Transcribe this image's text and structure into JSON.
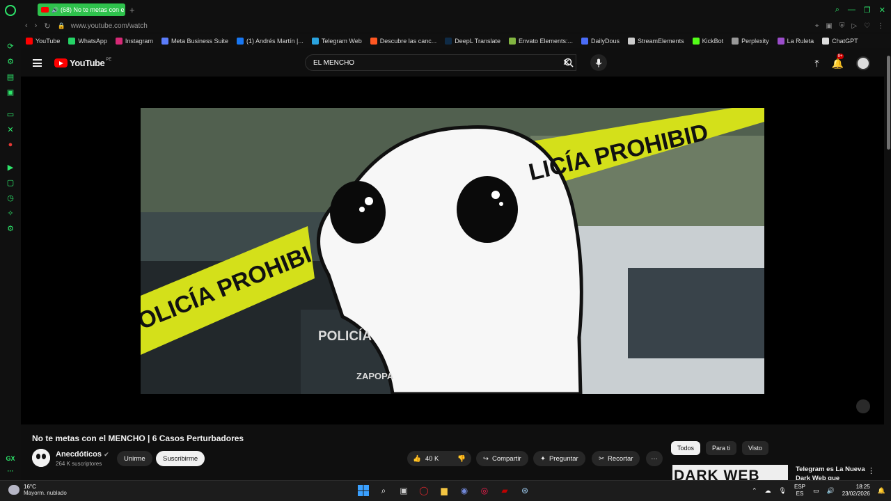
{
  "browser": {
    "tab_title": "(68) No te metas con e",
    "url": "www.youtube.com/watch",
    "bookmarks": [
      {
        "label": "YouTube",
        "color": "#ff0000"
      },
      {
        "label": "WhatsApp",
        "color": "#25d366"
      },
      {
        "label": "Instagram",
        "color": "#d62976"
      },
      {
        "label": "Meta Business Suite",
        "color": "#5b7cfa"
      },
      {
        "label": "(1) Andrés Martín |...",
        "color": "#1877f2"
      },
      {
        "label": "Telegram Web",
        "color": "#2aa3df"
      },
      {
        "label": "Descubre las canc...",
        "color": "#ff5722"
      },
      {
        "label": "DeepL Translate",
        "color": "#0f2b46"
      },
      {
        "label": "Envato Elements:...",
        "color": "#82b541"
      },
      {
        "label": "DailyDous",
        "color": "#4a6cf7"
      },
      {
        "label": "StreamElements",
        "color": "#cccccc"
      },
      {
        "label": "KickBot",
        "color": "#53fc18"
      },
      {
        "label": "Perplexity",
        "color": "#999999"
      },
      {
        "label": "La Ruleta",
        "color": "#9b4dca"
      },
      {
        "label": "ChatGPT",
        "color": "#dddddd"
      }
    ]
  },
  "youtube": {
    "logo_text": "YouTube",
    "country_code": "PE",
    "search_value": "EL MENCHO",
    "notification_badge": "9+"
  },
  "video": {
    "title": "No te metas con el MENCHO | 6 Casos Perturbadores",
    "channel": "Anecdóticos",
    "subscribers": "264 K suscriptores",
    "join_label": "Unirme",
    "subscribe_label": "Suscribirme",
    "likes": "40 K",
    "share_label": "Compartir",
    "ask_label": "Preguntar",
    "clip_label": "Recortar",
    "frame_text_tape_1": "LICÍA PROHIBID",
    "frame_text_tape_2": "OLICÍA PROHIBI",
    "frame_text_car": "POLICÍA",
    "frame_text_car_2": "ZAPOPA"
  },
  "sidebar": {
    "chips": [
      "Todos",
      "Para ti",
      "Visto"
    ],
    "related_thumb_text": "DARK WEB",
    "related_title": "Telegram es La Nueva Dark Web que"
  },
  "taskbar": {
    "temperature": "16°C",
    "weather": "Mayorm. nublado",
    "lang1": "ESP",
    "lang2": "ES",
    "time": "18:25",
    "date": "23/02/2026"
  }
}
